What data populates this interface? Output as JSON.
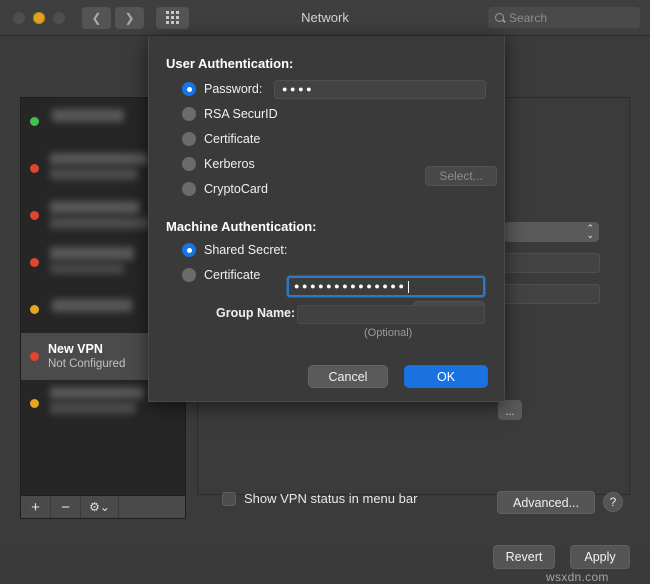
{
  "window": {
    "title": "Network",
    "traffic_lights": [
      "close",
      "minimize",
      "zoom"
    ],
    "nav_back_icon": "chevron-left-icon",
    "nav_forward_icon": "chevron-right-icon",
    "grid_icon": "show-all-icon",
    "search": {
      "placeholder": "Search",
      "value": "",
      "icon": "search-icon"
    }
  },
  "sidebar": {
    "items": [
      {
        "status": "green",
        "status_color": "#41c14b",
        "label": "",
        "sublabel": "",
        "blurred": true
      },
      {
        "status": "red",
        "status_color": "#e0452f",
        "label": "",
        "sublabel": "",
        "blurred": true
      },
      {
        "status": "red",
        "status_color": "#e0452f",
        "label": "",
        "sublabel": "",
        "blurred": true
      },
      {
        "status": "red",
        "status_color": "#e0452f",
        "label": "",
        "sublabel": "",
        "blurred": true
      },
      {
        "status": "amber",
        "status_color": "#e3a81e",
        "label": "",
        "sublabel": "",
        "blurred": true
      },
      {
        "status": "red",
        "status_color": "#e0452f",
        "label": "New VPN",
        "sublabel": "Not Configured",
        "blurred": false,
        "selected": true
      },
      {
        "status": "amber",
        "status_color": "#e3a81e",
        "label": "",
        "sublabel": "",
        "blurred": true
      }
    ],
    "toolbar": {
      "add_label": "+",
      "remove_label": "−",
      "action_icon": "gear-icon",
      "action_chevron": "⌄"
    }
  },
  "main": {
    "show_vpn_status_label": "Show VPN status in menu bar",
    "show_vpn_status_checked": false,
    "advanced_label": "Advanced...",
    "help_label": "?",
    "revert_label": "Revert",
    "apply_label": "Apply",
    "popup_arrows": "⇅",
    "small_button_label": "...",
    "watermark": "wsxdn.com"
  },
  "dialog": {
    "user_auth": {
      "title": "User Authentication:",
      "options": [
        {
          "label": "Password:",
          "selected": true
        },
        {
          "label": "RSA SecurID",
          "selected": false
        },
        {
          "label": "Certificate",
          "selected": false
        },
        {
          "label": "Kerberos",
          "selected": false
        },
        {
          "label": "CryptoCard",
          "selected": false
        }
      ],
      "password_value": "●●●●",
      "password_placeholder": "",
      "certificate_select_label": "Select..."
    },
    "machine_auth": {
      "title": "Machine Authentication:",
      "options": [
        {
          "label": "Shared Secret:",
          "selected": true
        },
        {
          "label": "Certificate",
          "selected": false
        }
      ],
      "shared_secret_value": "●●●●●●●●●●●●●●",
      "certificate_select_label": "Select..."
    },
    "group_name": {
      "label": "Group Name:",
      "value": "",
      "hint": "(Optional)"
    },
    "buttons": {
      "cancel_label": "Cancel",
      "ok_label": "OK"
    }
  },
  "colors": {
    "accent_blue": "#1673e8",
    "ok_button_blue": "#1a72e0",
    "focus_ring": "#2f79c4",
    "status_green": "#41c14b",
    "status_red": "#e0452f",
    "status_amber": "#e3a81e",
    "window_bg": "#3b3b3b",
    "sidebar_bg": "#262626"
  }
}
